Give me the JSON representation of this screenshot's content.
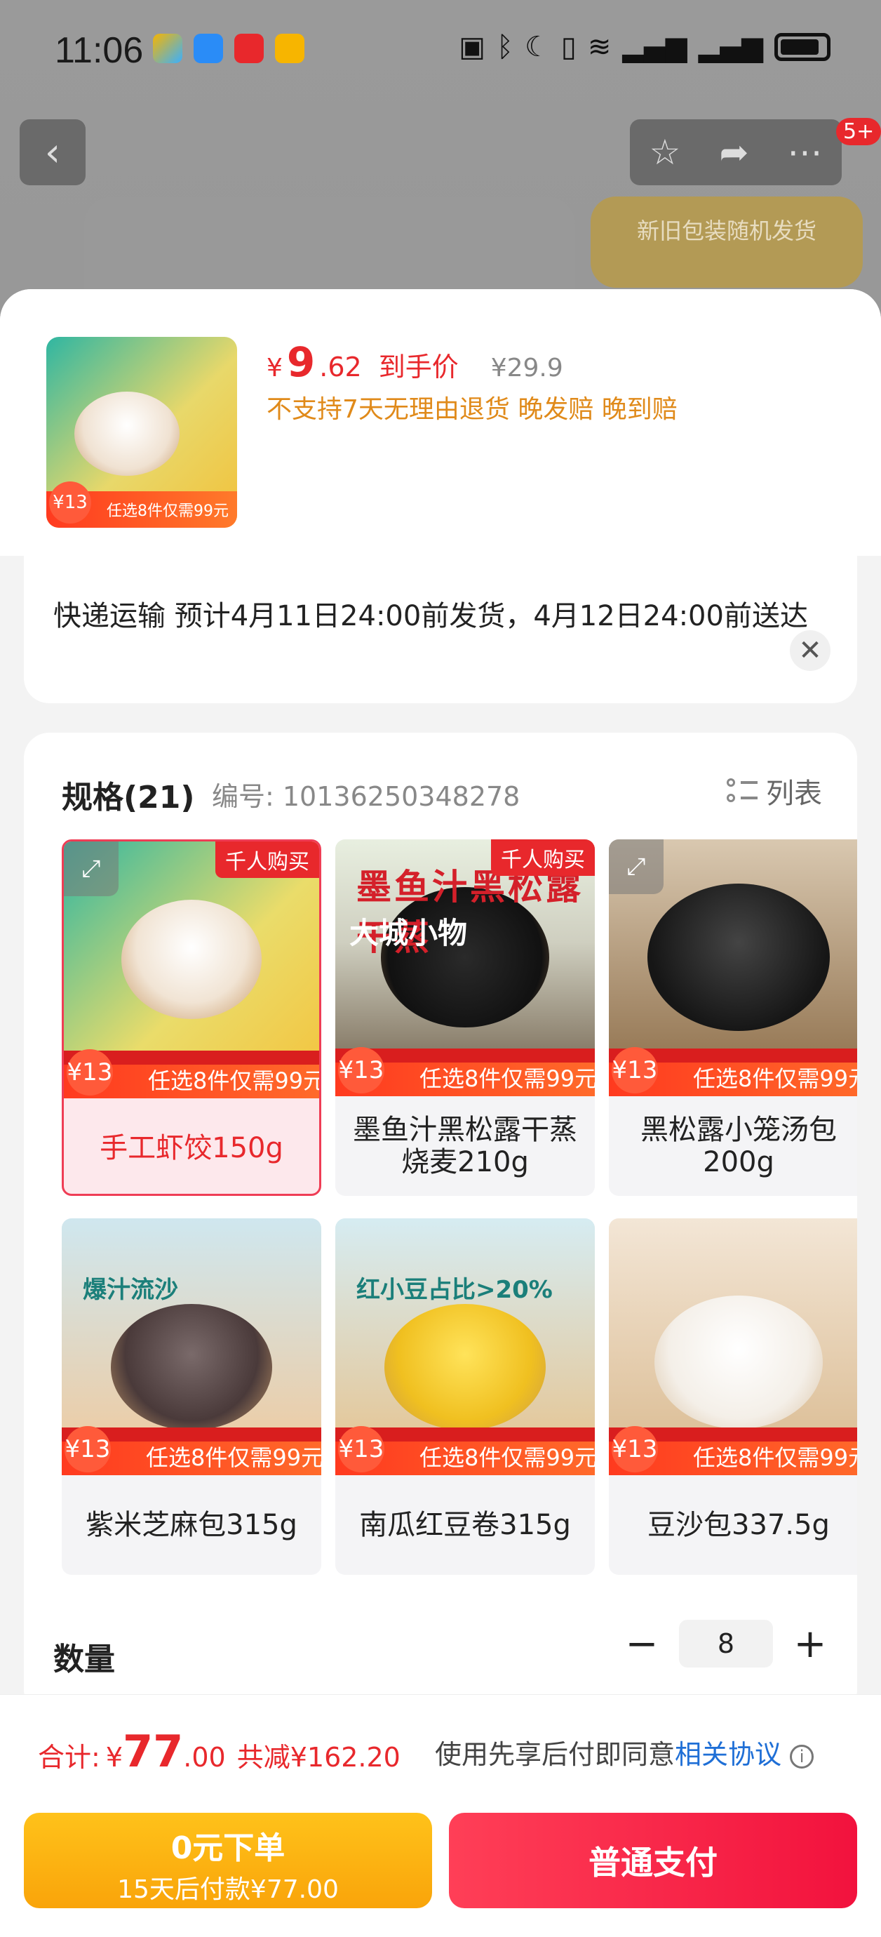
{
  "status_bar": {
    "time": "11:06"
  },
  "background": {
    "banner_text": "新旧包装随机发货",
    "notif_badge": "5+"
  },
  "header": {
    "price_symbol": "¥",
    "price_int": "9",
    "price_dec": ".62",
    "price_tag": "到手价",
    "original_price": "¥29.9",
    "policies": "不支持7天无理由退货  晚发赔  晚到赔",
    "thumb_badge": "¥13",
    "thumb_strip": "任选8件仅需99元"
  },
  "shipping": {
    "text": "快递运输 预计4月11日24:00前发货，4月12日24:00前送达"
  },
  "spec": {
    "title": "规格(21)",
    "code": "编号: 10136250348278",
    "view_toggle": "列表",
    "hot_label": "千人购买",
    "strip_price": "¥13",
    "strip_text": "任选8件仅需99元",
    "items": [
      {
        "name": "手工虾饺150g"
      },
      {
        "name": "墨鱼汁黑松露干蒸烧麦210g"
      },
      {
        "name": "黑松露小笼汤包200g"
      },
      {
        "name": "紫米芝麻包315g"
      },
      {
        "name": "南瓜红豆卷315g"
      },
      {
        "name": "豆沙包337.5g"
      }
    ],
    "item2_caption": "大城小物",
    "item2_title": "墨鱼汁黑松露干蒸",
    "item4_title": "爆汁流沙",
    "item5_title": "红小豆占比>20%"
  },
  "quantity": {
    "label": "数量",
    "value": "8"
  },
  "footer": {
    "total_label": "合计:",
    "total_symbol": "¥",
    "total_int": "77",
    "total_dec": ".00",
    "discount": "共减¥162.20",
    "agree_prefix": "使用先享后付即同意",
    "agree_link": "相关协议",
    "pay_later_title": "0元下单",
    "pay_later_sub": "15天后付款¥77.00",
    "pay_normal": "普通支付"
  },
  "colors": {
    "accent": "#e8282c",
    "policy": "#e08a1a",
    "pay_later": "#ffc21a",
    "link": "#1f6fd6"
  }
}
